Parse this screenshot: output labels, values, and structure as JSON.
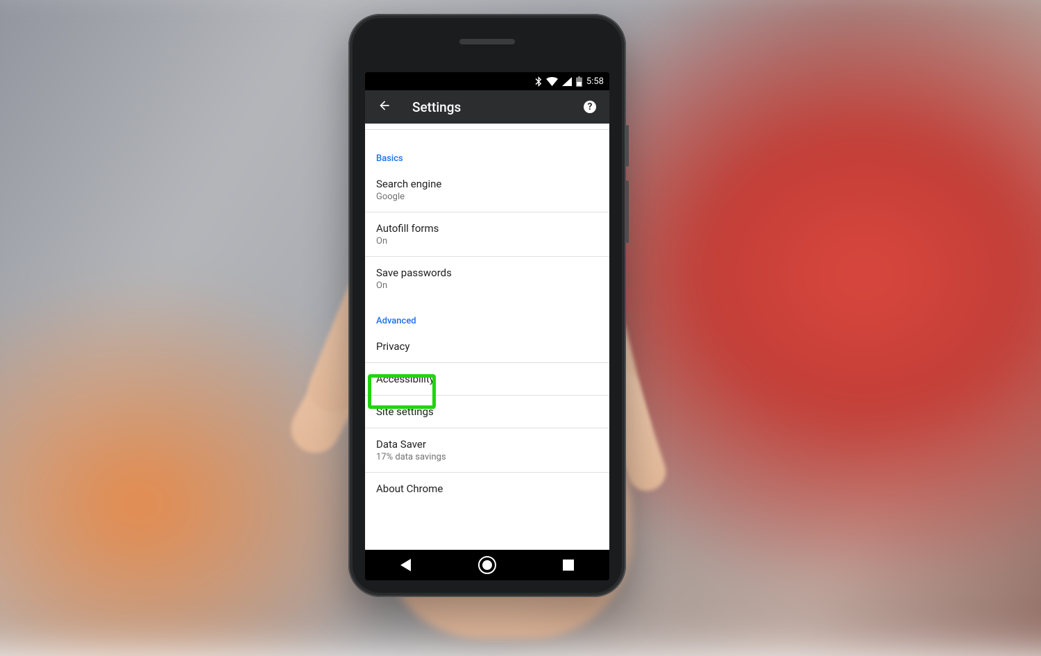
{
  "statusbar": {
    "time": "5:58"
  },
  "appbar": {
    "title": "Settings",
    "help_glyph": "?"
  },
  "sections": {
    "basics": {
      "header": "Basics",
      "search_engine": {
        "label": "Search engine",
        "value": "Google"
      },
      "autofill": {
        "label": "Autofill forms",
        "value": "On"
      },
      "save_pw": {
        "label": "Save passwords",
        "value": "On"
      }
    },
    "advanced": {
      "header": "Advanced",
      "privacy": {
        "label": "Privacy"
      },
      "accessibility": {
        "label": "Accessibility"
      },
      "site_settings": {
        "label": "Site settings"
      },
      "data_saver": {
        "label": "Data Saver",
        "value": "17% data savings"
      },
      "about": {
        "label": "About Chrome"
      }
    }
  },
  "highlight": {
    "target": "site_settings"
  }
}
